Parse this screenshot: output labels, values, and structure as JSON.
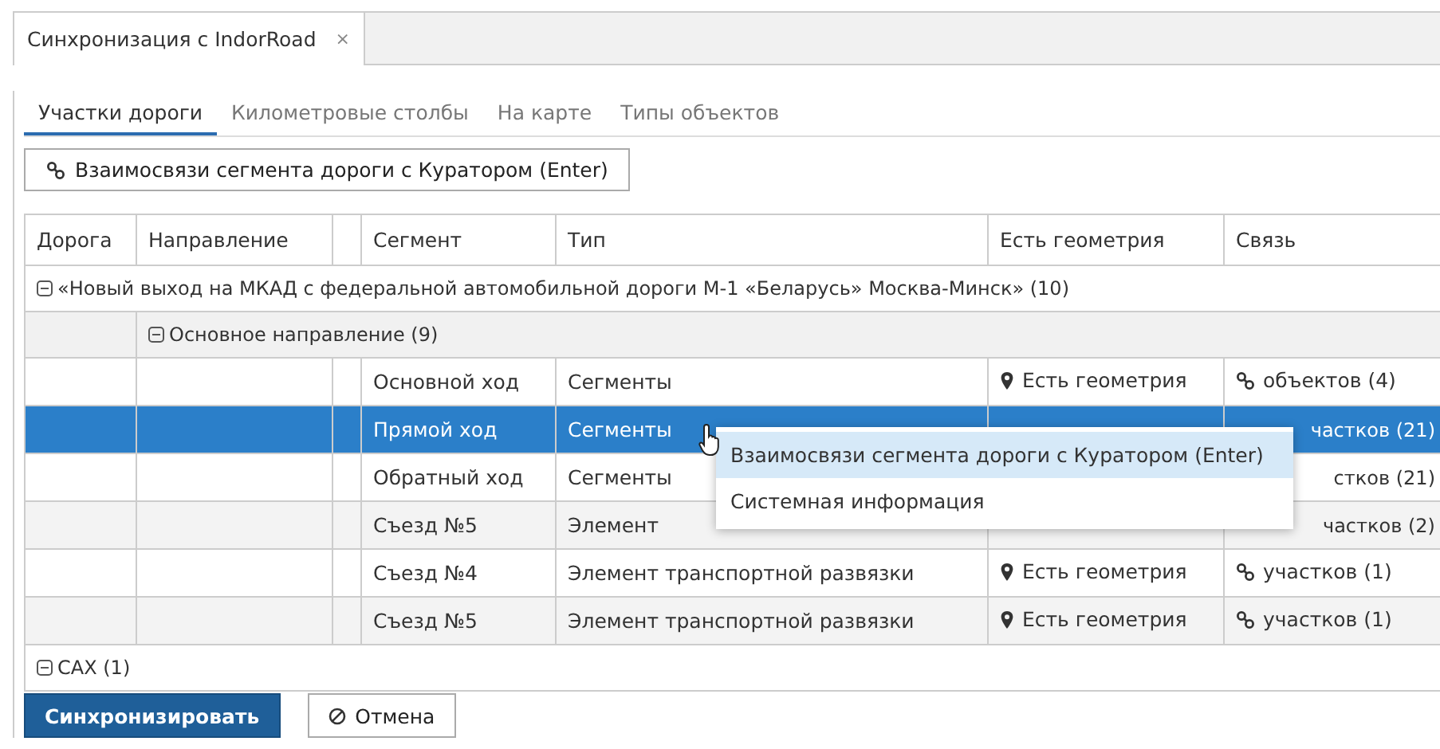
{
  "window_tab": {
    "title": "Синхронизация с IndorRoad",
    "close": "×"
  },
  "tabs": [
    {
      "label": "Участки дороги",
      "selected": true
    },
    {
      "label": "Километровые столбы",
      "selected": false
    },
    {
      "label": "На карте",
      "selected": false
    },
    {
      "label": "Типы объектов",
      "selected": false
    }
  ],
  "toolbar_button": "Взаимосвязи сегмента дороги с Куратором (Enter)",
  "table": {
    "columns": [
      "Дорога",
      "Направление",
      "",
      "Сегмент",
      "Тип",
      "Есть геометрия",
      "Связь"
    ],
    "rows": [
      {
        "kind": "group",
        "label": "«Новый выход на МКАД с федеральной автомобильной дороги М-1 «Беларусь» Москва-Минск» (10)",
        "expanded": true
      },
      {
        "kind": "subgroup",
        "label": "Основное направление (9)",
        "expanded": true
      },
      {
        "kind": "data",
        "segment": "Основной ход",
        "type": "Сегменты",
        "geometry": "Есть геометрия",
        "link": "объектов (4)",
        "selected": false
      },
      {
        "kind": "covered",
        "segment": "Прямой ход",
        "type": "Сегменты",
        "link": "частков (21)",
        "selected": true
      },
      {
        "kind": "covered",
        "segment": "Обратный ход",
        "type": "Сегменты",
        "link": "стков (21)",
        "selected": false
      },
      {
        "kind": "covered",
        "segment": "Съезд №5",
        "type": "Элемент",
        "link": "частков (2)",
        "selected": false
      },
      {
        "kind": "data",
        "segment": "Съезд №4",
        "type": "Элемент транспортной развязки",
        "geometry": "Есть геометрия",
        "link": "участков (1)",
        "selected": false
      },
      {
        "kind": "data",
        "segment": "Съезд №5",
        "type": "Элемент транспортной развязки",
        "geometry": "Есть геометрия",
        "link": "участков (1)",
        "selected": false
      },
      {
        "kind": "group",
        "label": "САХ (1)",
        "expanded": true
      }
    ]
  },
  "context_menu": [
    {
      "label": "Взаимосвязи сегмента дороги с Куратором (Enter)",
      "selected": true
    },
    {
      "label": "Системная информация",
      "selected": false
    }
  ],
  "buttons": [
    {
      "label": "Синхронизировать",
      "kind": "primary"
    },
    {
      "label": "Отмена",
      "kind": "cancel"
    }
  ]
}
